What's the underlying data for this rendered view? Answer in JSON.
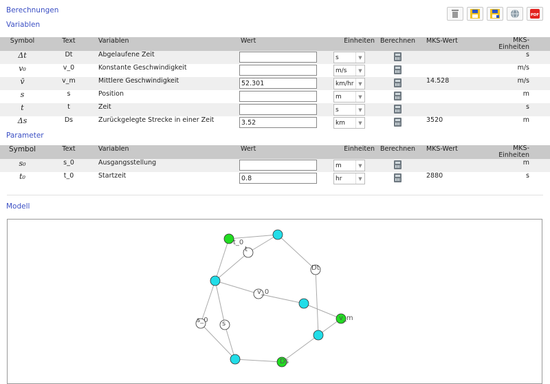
{
  "header": {
    "berechnungen": "Berechnungen",
    "variablen": "Variablen",
    "parameter": "Parameter",
    "modell": "Modell"
  },
  "toolbar": {
    "icons": [
      "trash-icon",
      "save-icon",
      "save-as-icon",
      "globe-icon",
      "pdf-icon"
    ],
    "pdf_label": "PDF"
  },
  "columns": {
    "symbol": "Symbol",
    "text": "Text",
    "variablen": "Variablen",
    "wert": "Wert",
    "einheiten": "Einheiten",
    "berechnen": "Berechnen",
    "mks_wert": "MKS-Wert",
    "mks_einheiten_1": "MKS-",
    "mks_einheiten_2": "Einheiten"
  },
  "variables": [
    {
      "symbol": "Δt",
      "text": "Dt",
      "name": "Abgelaufene Zeit",
      "wert": "",
      "unit": "s",
      "mks": "",
      "mks_unit": "s"
    },
    {
      "symbol": "v₀",
      "text": "v_0",
      "name": "Konstante Geschwindigkeit",
      "wert": "",
      "unit": "m/s",
      "mks": "",
      "mks_unit": "m/s"
    },
    {
      "symbol": "v̄",
      "text": "v_m",
      "name": "Mittlere Geschwindigkeit",
      "wert": "52.301",
      "unit": "km/hr",
      "mks": "14.528",
      "mks_unit": "m/s"
    },
    {
      "symbol": "s",
      "text": "s",
      "name": "Position",
      "wert": "",
      "unit": "m",
      "mks": "",
      "mks_unit": "m"
    },
    {
      "symbol": "t",
      "text": "t",
      "name": "Zeit",
      "wert": "",
      "unit": "s",
      "mks": "",
      "mks_unit": "s"
    },
    {
      "symbol": "Δs",
      "text": "Ds",
      "name": "Zurückgelegte Strecke in einer Zeit",
      "wert": "3.52",
      "unit": "km",
      "mks": "3520",
      "mks_unit": "m"
    }
  ],
  "parameters": [
    {
      "symbol": "s₀",
      "text": "s_0",
      "name": "Ausgangsstellung",
      "wert": "",
      "unit": "m",
      "mks": "",
      "mks_unit": "m"
    },
    {
      "symbol": "t₀",
      "text": "t_0",
      "name": "Startzeit",
      "wert": "0.8",
      "unit": "hr",
      "mks": "2880",
      "mks_unit": "s"
    }
  ],
  "graph": {
    "colors": {
      "green": "#22dd22",
      "cyan": "#22dde8",
      "white": "#ffffff"
    },
    "nodes": [
      {
        "id": "t0",
        "label": "t_0",
        "color": "green"
      },
      {
        "id": "eq1",
        "label": "",
        "color": "cyan"
      },
      {
        "id": "t",
        "label": "t",
        "color": "white"
      },
      {
        "id": "Dt",
        "label": "Dt",
        "color": "white"
      },
      {
        "id": "eq2",
        "label": "",
        "color": "cyan"
      },
      {
        "id": "v0",
        "label": "v_0",
        "color": "white"
      },
      {
        "id": "eq3",
        "label": "",
        "color": "cyan"
      },
      {
        "id": "vm",
        "label": "v_m",
        "color": "green"
      },
      {
        "id": "s0",
        "label": "s_0",
        "color": "white"
      },
      {
        "id": "s",
        "label": "s",
        "color": "white"
      },
      {
        "id": "eq4",
        "label": "",
        "color": "cyan"
      },
      {
        "id": "eq5",
        "label": "",
        "color": "cyan"
      },
      {
        "id": "Ds",
        "label": "Ds",
        "color": "green"
      }
    ],
    "edges": [
      [
        "t0",
        "eq1"
      ],
      [
        "t0",
        "eq2"
      ],
      [
        "eq1",
        "t"
      ],
      [
        "eq1",
        "Dt"
      ],
      [
        "t",
        "eq2"
      ],
      [
        "eq2",
        "v0"
      ],
      [
        "v0",
        "eq3"
      ],
      [
        "eq3",
        "vm"
      ],
      [
        "Dt",
        "eq4"
      ],
      [
        "vm",
        "eq4"
      ],
      [
        "eq4",
        "Ds"
      ],
      [
        "Ds",
        "eq5"
      ],
      [
        "eq2",
        "s0"
      ],
      [
        "s0",
        "eq5"
      ],
      [
        "eq2",
        "s"
      ],
      [
        "s",
        "eq5"
      ]
    ]
  }
}
